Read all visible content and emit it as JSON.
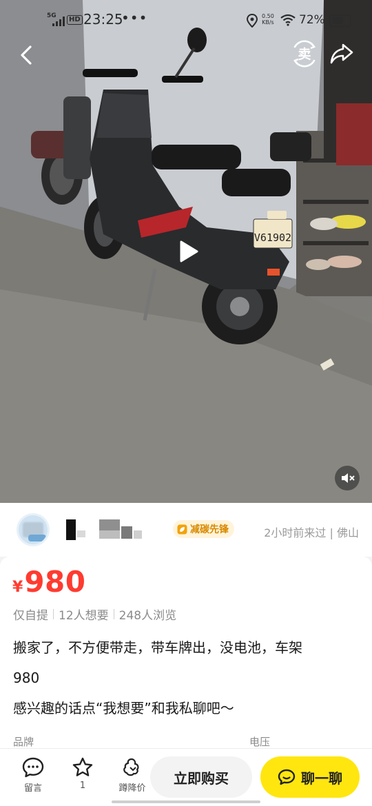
{
  "status_bar": {
    "network": "5G",
    "hd": "HD",
    "time": "23:25",
    "more": "•••",
    "speed_value": "0.50",
    "speed_unit": "KB/s",
    "battery": "72%",
    "battery_level": 0.72
  },
  "media": {
    "license_plate": "V61902",
    "icons": [
      "back-icon",
      "sell-icon",
      "share-icon",
      "play-icon",
      "mute-icon"
    ]
  },
  "nav": {
    "sell_glyph": "卖"
  },
  "seller": {
    "badge": "减碳先锋",
    "last_seen": "2小时前来过 | 佛山"
  },
  "item": {
    "currency": "¥",
    "price": "980",
    "pickup": "仅自提",
    "wants": "12人想要",
    "views": "248人浏览",
    "description_line1": "搬家了，不方便带走，带车牌出，没电池，车架",
    "description_line2": "980",
    "description_line3": "感兴趣的话点“我想要”和我私聊吧～",
    "attr_brand_label": "品牌",
    "attr_voltage_label": "电压"
  },
  "bottom_bar": {
    "comment_label": "留言",
    "favorite_count": "1",
    "price_drop_label": "蹲降价",
    "buy_label": "立即购买",
    "chat_label": "聊一聊"
  },
  "colors": {
    "price_red": "#ff3b30",
    "chat_yellow": "#ffe60f",
    "badge_orange": "#d98a00"
  }
}
